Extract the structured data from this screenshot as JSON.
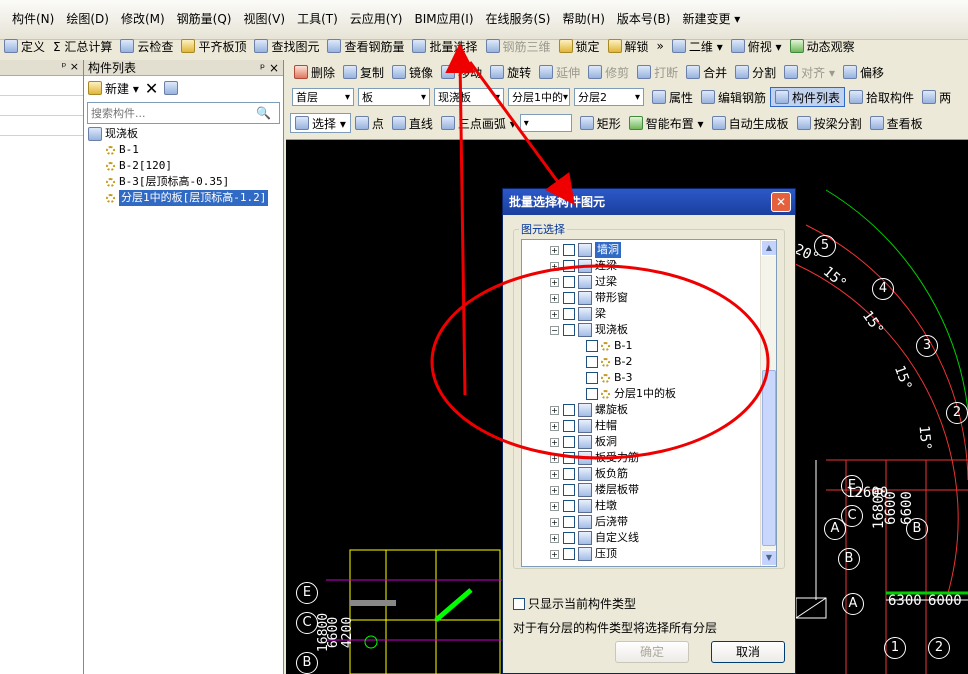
{
  "menu": [
    "构件(N)",
    "绘图(D)",
    "修改(M)",
    "钢筋量(Q)",
    "视图(V)",
    "工具(T)",
    "云应用(Y)",
    "BIM应用(I)",
    "在线服务(S)",
    "帮助(H)",
    "版本号(B)",
    "新建变更 ▾"
  ],
  "toolbar1": [
    {
      "label": "定义",
      "icon": "define-icon",
      "c": ""
    },
    {
      "label": "Σ 汇总计算",
      "icon": "",
      "c": ""
    },
    {
      "label": "云检查",
      "icon": "cloud-check-icon",
      "c": ""
    },
    {
      "label": "平齐板顶",
      "icon": "align-slab-icon",
      "c": "y"
    },
    {
      "label": "查找图元",
      "icon": "find-element-icon",
      "c": ""
    },
    {
      "label": "查看钢筋量",
      "icon": "view-rebar-icon",
      "c": ""
    },
    {
      "label": "批量选择",
      "icon": "batch-select-icon",
      "c": ""
    },
    {
      "label": "钢筋三维",
      "icon": "rebar-3d-icon",
      "c": "",
      "disabled": true
    },
    {
      "label": "锁定",
      "icon": "lock-icon",
      "c": "y"
    },
    {
      "label": "解锁",
      "icon": "unlock-icon",
      "c": "y"
    },
    {
      "label": "二维 ▾",
      "icon": "2d-icon",
      "c": ""
    },
    {
      "label": "俯视 ▾",
      "icon": "top-view-icon",
      "c": ""
    },
    {
      "label": "动态观察",
      "icon": "orbit-icon",
      "c": "g"
    }
  ],
  "panel": {
    "title": "构件列表",
    "pin": "ᵖ ×",
    "new_btn": "新建 ▾",
    "search_placeholder": "搜索构件..."
  },
  "tree": {
    "root": "现浇板",
    "items": [
      "B-1",
      "B-2[120]",
      "B-3[层顶标高-0.35]",
      "分层1中的板[层顶标高-1.2]"
    ]
  },
  "wtb1": [
    "删除",
    "复制",
    "镜像",
    "移动",
    "旋转",
    "延伸",
    "修剪",
    "打断",
    "合并",
    "分割",
    "对齐 ▾",
    "偏移"
  ],
  "wtb2": {
    "floor": "首层",
    "type": "板",
    "sub": "现浇板",
    "layer": "分层1中的",
    "comp": "分层2",
    "btns": [
      "属性",
      "编辑钢筋",
      "构件列表",
      "拾取构件",
      "两"
    ]
  },
  "wtb3": [
    "选择 ▾",
    "点",
    "直线",
    "三点画弧 ▾",
    "",
    "矩形",
    "智能布置 ▾",
    "自动生成板",
    "按梁分割",
    "查看板"
  ],
  "dialog": {
    "title": "批量选择构件图元",
    "group": "图元选择",
    "rows": [
      {
        "l": "墙洞",
        "pm": "+",
        "lvl": 0,
        "hl": true
      },
      {
        "l": "连梁",
        "pm": "+",
        "lvl": 0
      },
      {
        "l": "过梁",
        "pm": "+",
        "lvl": 0
      },
      {
        "l": "带形窗",
        "pm": "+",
        "lvl": 0
      },
      {
        "l": "梁",
        "pm": "+",
        "lvl": 0
      },
      {
        "l": "现浇板",
        "pm": "−",
        "lvl": 0
      },
      {
        "l": "B-1",
        "lvl": 1
      },
      {
        "l": "B-2",
        "lvl": 1
      },
      {
        "l": "B-3",
        "lvl": 1
      },
      {
        "l": "分层1中的板",
        "lvl": 1
      },
      {
        "l": "螺旋板",
        "pm": "+",
        "lvl": 0
      },
      {
        "l": "柱帽",
        "pm": "+",
        "lvl": 0
      },
      {
        "l": "板洞",
        "pm": "+",
        "lvl": 0
      },
      {
        "l": "板受力筋",
        "pm": "+",
        "lvl": 0
      },
      {
        "l": "板负筋",
        "pm": "+",
        "lvl": 0
      },
      {
        "l": "楼层板带",
        "pm": "+",
        "lvl": 0
      },
      {
        "l": "柱墩",
        "pm": "+",
        "lvl": 0
      },
      {
        "l": "后浇带",
        "pm": "+",
        "lvl": 0
      },
      {
        "l": "自定义线",
        "pm": "+",
        "lvl": 0
      },
      {
        "l": "压顶",
        "pm": "+",
        "lvl": 0
      }
    ],
    "only_current": "只显示当前构件类型",
    "note": "对于有分层的构件类型将选择所有分层",
    "ok": "确定",
    "cancel": "取消"
  },
  "cad": {
    "axes": [
      "5",
      "4",
      "3",
      "2",
      "E",
      "C",
      "B",
      "A",
      "A",
      "B",
      "1",
      "2"
    ],
    "angles": [
      "20°",
      "15°",
      "15°",
      "15°",
      "15°"
    ],
    "dims": [
      "12600",
      "16800",
      "6600",
      "6600",
      "6300",
      "6000",
      "6300"
    ],
    "left_axes": [
      "E",
      "C",
      "B"
    ],
    "left_dims": [
      "16800",
      "6600",
      "4200"
    ]
  }
}
